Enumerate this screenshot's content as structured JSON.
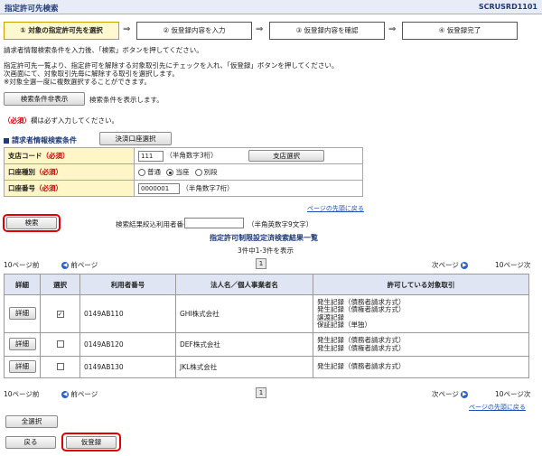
{
  "header": {
    "title": "指定許可先検索",
    "screen_id": "SCRUSRD1101"
  },
  "steps": [
    {
      "label": "① 対象の指定許可先を選択"
    },
    {
      "label": "② 仮登録内容を入力"
    },
    {
      "label": "③ 仮登録内容を確認"
    },
    {
      "label": "④ 仮登録完了"
    }
  ],
  "step_arrow": "⇒",
  "intro": {
    "line1": "請求者情報検索条件を入力後、「検索」ボタンを押してください。",
    "line2": "指定許可先一覧より、指定許可を解除する対象取引先にチェックを入れ、「仮登録」ボタンを押してください。",
    "line3": "次画面にて、対象取引先毎に解除する取引を選択します。",
    "line4": "※対象全選一度に複数選択することができます。"
  },
  "search_toggle": {
    "button": "検索条件非表示",
    "desc": "検索条件を表示します。"
  },
  "required_note": {
    "mark": "（必須）",
    "text": "欄は必ず入力してください。"
  },
  "search_section": {
    "title": "請求者情報検索条件",
    "account_select_button": "決済口座選択",
    "rows": {
      "branch": {
        "label": "支店コード",
        "req": "（必須）",
        "value": "111",
        "hint": "（半角数字3桁）",
        "button": "支店選択"
      },
      "type": {
        "label": "口座種別",
        "req": "（必須）",
        "options": [
          "普通",
          "当座",
          "別段"
        ],
        "selected": "当座"
      },
      "number": {
        "label": "口座番号",
        "req": "（必須）",
        "value": "0000001",
        "hint": "（半角数字7桁）"
      }
    },
    "top_link": "ページの先頭に戻る"
  },
  "search_button": "検索",
  "refine": {
    "label": "検索結果絞込利用者番号",
    "value": "",
    "hint": "（半角英数字9文字）"
  },
  "results": {
    "title": "指定許可制限設定済検索結果一覧",
    "count": "3件中1-3件を表示",
    "pager": {
      "prev10": "10ページ前",
      "prev": "前ページ",
      "page": "1",
      "next": "次ページ",
      "next10": "10ページ次"
    },
    "columns": [
      "詳細",
      "選択",
      "利用者番号",
      "法人名／個人事業者名",
      "許可している対象取引"
    ],
    "rows": [
      {
        "detail": "詳細",
        "checked": true,
        "user_no": "0149AB110",
        "name": "GHI株式会社",
        "trades": [
          "発生記録（債務者請求方式）",
          "発生記録（債権者請求方式）",
          "譲渡記録",
          "保証記録（単独）"
        ]
      },
      {
        "detail": "詳細",
        "checked": false,
        "user_no": "0149AB120",
        "name": "DEF株式会社",
        "trades": [
          "発生記録（債務者請求方式）",
          "発生記録（債権者請求方式）"
        ]
      },
      {
        "detail": "詳細",
        "checked": false,
        "user_no": "0149AB130",
        "name": "JKL株式会社",
        "trades": [
          "発生記録（債務者請求方式）"
        ]
      }
    ],
    "check_mark": "✓",
    "top_link": "ページの先頭に戻る"
  },
  "bottom": {
    "select_all": "全選択",
    "back": "戻る",
    "register": "仮登録"
  }
}
